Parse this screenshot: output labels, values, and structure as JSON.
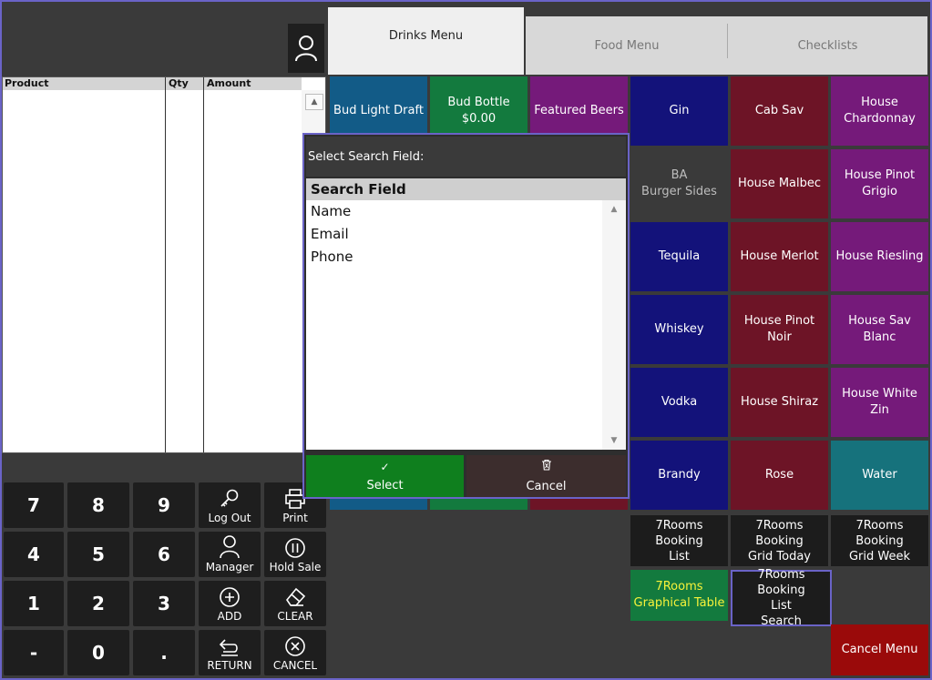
{
  "tabs": {
    "drinks": "Drinks Menu",
    "food": "Food Menu",
    "checklists": "Checklists"
  },
  "order": {
    "col_product": "Product",
    "col_qty": "Qty",
    "col_amount": "Amount"
  },
  "keypad": {
    "k7": "7",
    "k8": "8",
    "k9": "9",
    "k4": "4",
    "k5": "5",
    "k6": "6",
    "k1": "1",
    "k2": "2",
    "k3": "3",
    "kminus": "-",
    "k0": "0",
    "kdot": "."
  },
  "functions": {
    "logout": "Log Out",
    "print": "Print",
    "manager": "Manager",
    "hold_sale": "Hold Sale",
    "add": "ADD",
    "clear": "CLEAR",
    "return": "RETURN",
    "cancel": "CANCEL"
  },
  "tiles": {
    "bud_light": "Bud Light Draft",
    "bud_bottle_name": "Bud Bottle",
    "bud_bottle_price": "$0.00",
    "featured_beers": "Featured Beers",
    "gin": "Gin",
    "cab_sav": "Cab Sav",
    "house_chardonnay_1": "House",
    "house_chardonnay_2": "Chardonnay",
    "ba_1": "BA",
    "ba_2": "Burger Sides",
    "house_malbec": "House Malbec",
    "house_pinot_grigio_1": "House Pinot",
    "house_pinot_grigio_2": "Grigio",
    "tequila": "Tequila",
    "house_merlot": "House Merlot",
    "house_riesling": "House Riesling",
    "whiskey": "Whiskey",
    "house_pinot_noir_1": "House Pinot",
    "house_pinot_noir_2": "Noir",
    "house_sav_blanc": "House Sav Blanc",
    "vodka": "Vodka",
    "house_shiraz": "House Shiraz",
    "house_white_zin_1": "House White",
    "house_white_zin_2": "Zin",
    "brandy": "Brandy",
    "rose": "Rose",
    "water": "Water",
    "booking_list_1": "7Rooms",
    "booking_list_2": "Booking",
    "booking_list_3": "List",
    "grid_today_1": "7Rooms",
    "grid_today_2": "Booking",
    "grid_today_3": "Grid Today",
    "grid_week_1": "7Rooms",
    "grid_week_2": "Booking",
    "grid_week_3": "Grid Week",
    "graphical_1": "7Rooms",
    "graphical_2": "Graphical Table",
    "list_search_1": "7Rooms Booking",
    "list_search_2": "List",
    "list_search_3": "Search",
    "cancel_menu": "Cancel Menu"
  },
  "dialog": {
    "title": "Select Search Field:",
    "header": "Search Field",
    "items": [
      "Name",
      "Email",
      "Phone"
    ],
    "select_label": "Select",
    "cancel_label": "Cancel"
  },
  "colors": {
    "navy": "#13127a",
    "maroon": "#6d1426",
    "purple": "#751a7a",
    "teal": "#16727c",
    "green": "#137a3e",
    "red": "#9a0a0a",
    "highlight": "#6a63c7"
  }
}
